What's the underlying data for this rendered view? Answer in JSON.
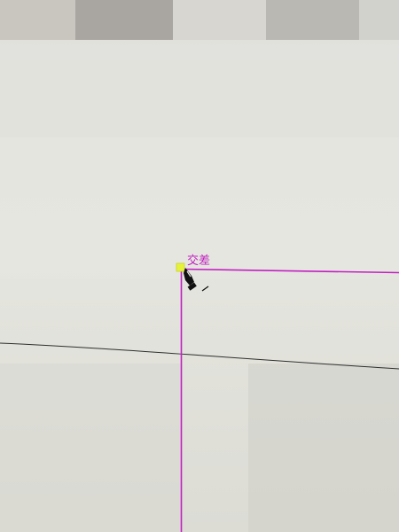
{
  "canvas": {
    "background": "#e3e3de"
  },
  "smart_guide": {
    "label": "交差",
    "color": "#c21fc2"
  },
  "anchor_point": {
    "color": "#e6f23a"
  },
  "path_line": {
    "color": "#2e2e2e"
  },
  "cursor": {
    "icon": "pen-tool-icon",
    "modifier": "slash"
  }
}
